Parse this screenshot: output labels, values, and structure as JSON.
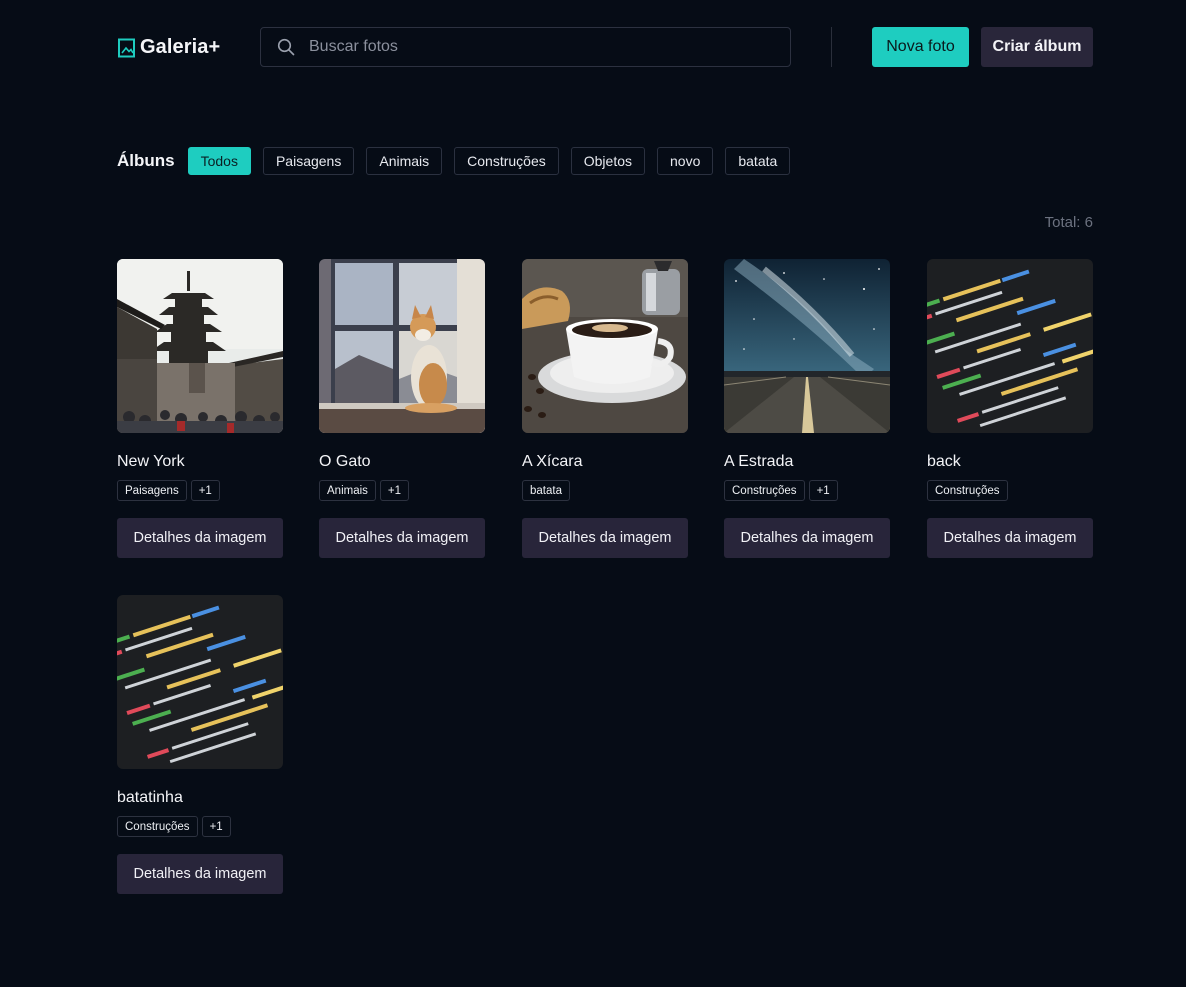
{
  "header": {
    "logo_text": "Galeria+",
    "search_placeholder": "Buscar fotos",
    "new_photo_label": "Nova foto",
    "create_album_label": "Criar álbum"
  },
  "albums": {
    "label": "Álbuns",
    "filters": [
      {
        "label": "Todos",
        "active": true
      },
      {
        "label": "Paisagens",
        "active": false
      },
      {
        "label": "Animais",
        "active": false
      },
      {
        "label": "Construções",
        "active": false
      },
      {
        "label": "Objetos",
        "active": false
      },
      {
        "label": "novo",
        "active": false
      },
      {
        "label": "batata",
        "active": false
      }
    ]
  },
  "total_label": "Total: 6",
  "details_button_label": "Detalhes da imagem",
  "photos": [
    {
      "title": "New York",
      "tags": [
        "Paisagens",
        "+1"
      ],
      "image": "pagoda-street"
    },
    {
      "title": "O Gato",
      "tags": [
        "Animais",
        "+1"
      ],
      "image": "cat-window"
    },
    {
      "title": "A Xícara",
      "tags": [
        "batata"
      ],
      "image": "coffee-cup"
    },
    {
      "title": "A Estrada",
      "tags": [
        "Construções",
        "+1"
      ],
      "image": "road-milky-way"
    },
    {
      "title": "back",
      "tags": [
        "Construções"
      ],
      "image": "code-screen"
    },
    {
      "title": "batatinha",
      "tags": [
        "Construções",
        "+1"
      ],
      "image": "code-screen"
    }
  ],
  "colors": {
    "background": "#060c16",
    "accent": "#1ecdc0",
    "secondary_button": "#28253a"
  }
}
